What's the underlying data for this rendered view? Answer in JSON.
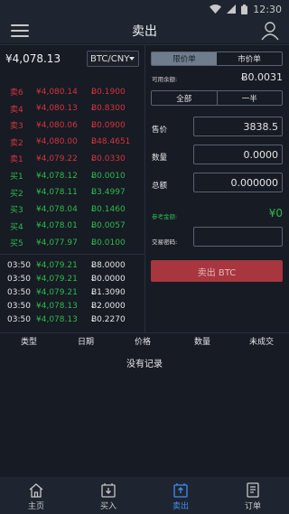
{
  "status_bar": {
    "time": "12:30"
  },
  "header": {
    "title": "卖出"
  },
  "orderbook": {
    "last_price": "¥4,078.13",
    "pair": "BTC/CNY",
    "asks": [
      {
        "label": "卖6",
        "price": "¥4,080.14",
        "amount": "Ƀ0.1900"
      },
      {
        "label": "卖4",
        "price": "¥4,080.13",
        "amount": "Ƀ0.8300"
      },
      {
        "label": "卖3",
        "price": "¥4,080.06",
        "amount": "Ƀ0.0900"
      },
      {
        "label": "卖2",
        "price": "¥4,080.00",
        "amount": "Ƀ48.4651"
      },
      {
        "label": "卖1",
        "price": "¥4,079.22",
        "amount": "Ƀ0.0330"
      }
    ],
    "bids": [
      {
        "label": "买1",
        "price": "¥4,078.12",
        "amount": "Ƀ0.0010"
      },
      {
        "label": "买2",
        "price": "¥4,078.11",
        "amount": "Ƀ3.4997"
      },
      {
        "label": "买3",
        "price": "¥4,078.04",
        "amount": "Ƀ0.1460"
      },
      {
        "label": "买4",
        "price": "¥4,078.01",
        "amount": "Ƀ0.0057"
      },
      {
        "label": "买5",
        "price": "¥4,077.97",
        "amount": "Ƀ0.0100"
      }
    ]
  },
  "trades": [
    {
      "time": "03:50",
      "price": "¥4,079.21",
      "amount": "Ƀ8.0000"
    },
    {
      "time": "03:50",
      "price": "¥4,079.21",
      "amount": "Ƀ0.0000"
    },
    {
      "time": "03:50",
      "price": "¥4,079.21",
      "amount": "Ƀ1.3090"
    },
    {
      "time": "03:50",
      "price": "¥4,078.13",
      "amount": "Ƀ2.0000"
    },
    {
      "time": "03:50",
      "price": "¥4,078.13",
      "amount": "Ƀ0.2270"
    }
  ],
  "form": {
    "tab_limit": "限价单",
    "tab_market": "市价单",
    "available_label": "可用余额:",
    "available_value": "Ƀ0.0031",
    "btn_all": "全部",
    "btn_half": "一半",
    "price_label": "售价",
    "price_value": "3838.5",
    "qty_label": "数量",
    "qty_value": "0.0000",
    "total_label": "总额",
    "total_value": "0.000000",
    "ref_label": "参考金额:",
    "ref_value": "¥0",
    "pwd_label": "交易密码:",
    "pwd_value": "",
    "submit": "卖出 BTC"
  },
  "orders_table": {
    "headers": [
      "类型",
      "日期",
      "价格",
      "数量",
      "未成交"
    ],
    "empty": "没有记录"
  },
  "tabbar": [
    {
      "label": "主页",
      "icon": "home-icon"
    },
    {
      "label": "买入",
      "icon": "buy-icon"
    },
    {
      "label": "卖出",
      "icon": "sell-icon"
    },
    {
      "label": "订单",
      "icon": "orders-icon"
    }
  ],
  "colors": {
    "sell": "#d6343a",
    "buy": "#2fba4a",
    "accent": "#3d8ef0",
    "submit_bg": "#a7363f"
  }
}
